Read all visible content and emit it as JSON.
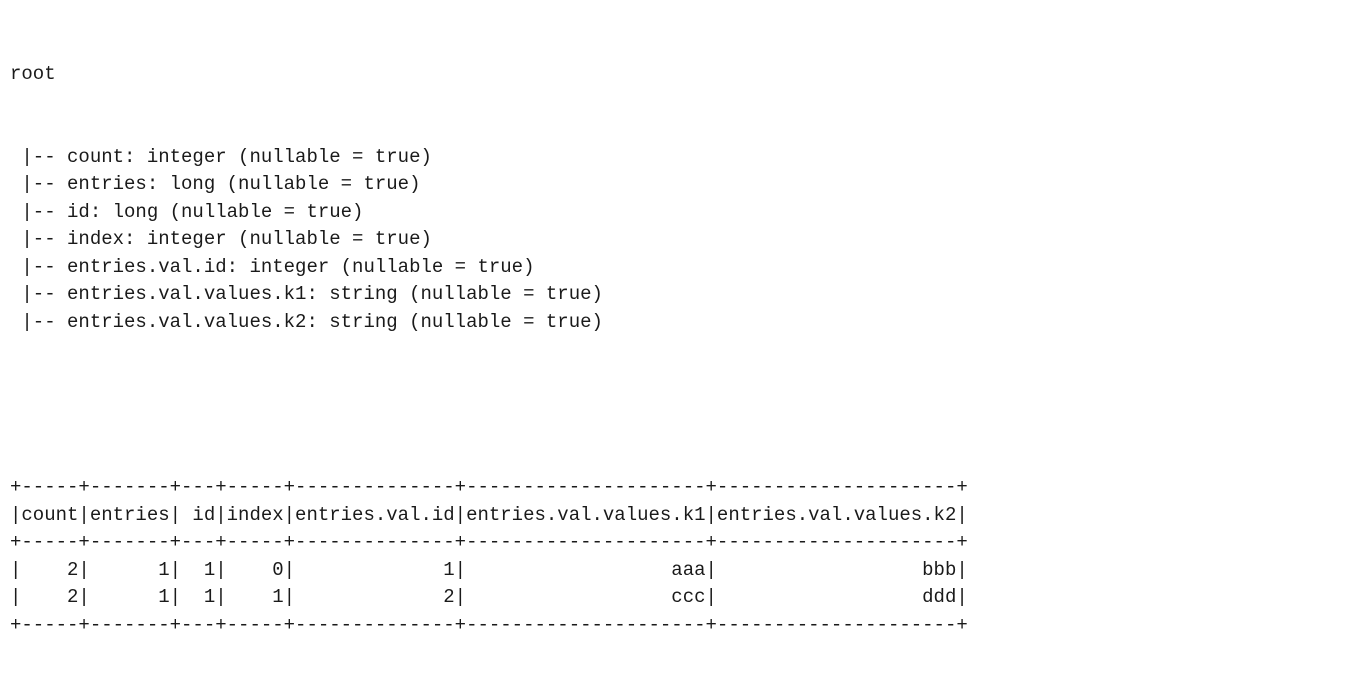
{
  "schema": {
    "root_label": "root",
    "branch_prefix": " |-- ",
    "nullable_suffix": " (nullable = true)",
    "fields": [
      {
        "name": "count",
        "type": "integer"
      },
      {
        "name": "entries",
        "type": "long"
      },
      {
        "name": "id",
        "type": "long"
      },
      {
        "name": "index",
        "type": "integer"
      },
      {
        "name": "entries.val.id",
        "type": "integer"
      },
      {
        "name": "entries.val.values.k1",
        "type": "string"
      },
      {
        "name": "entries.val.values.k2",
        "type": "string"
      }
    ]
  },
  "table": {
    "columns": [
      {
        "name": "count",
        "width": 5
      },
      {
        "name": "entries",
        "width": 7
      },
      {
        "name": " id",
        "width": 3
      },
      {
        "name": "index",
        "width": 5
      },
      {
        "name": "entries.val.id",
        "width": 14
      },
      {
        "name": "entries.val.values.k1",
        "width": 21
      },
      {
        "name": "entries.val.values.k2",
        "width": 21
      }
    ],
    "rows": [
      [
        "2",
        "1",
        "1",
        "0",
        "1",
        "aaa",
        "bbb"
      ],
      [
        "2",
        "1",
        "1",
        "1",
        "2",
        "ccc",
        "ddd"
      ]
    ]
  }
}
